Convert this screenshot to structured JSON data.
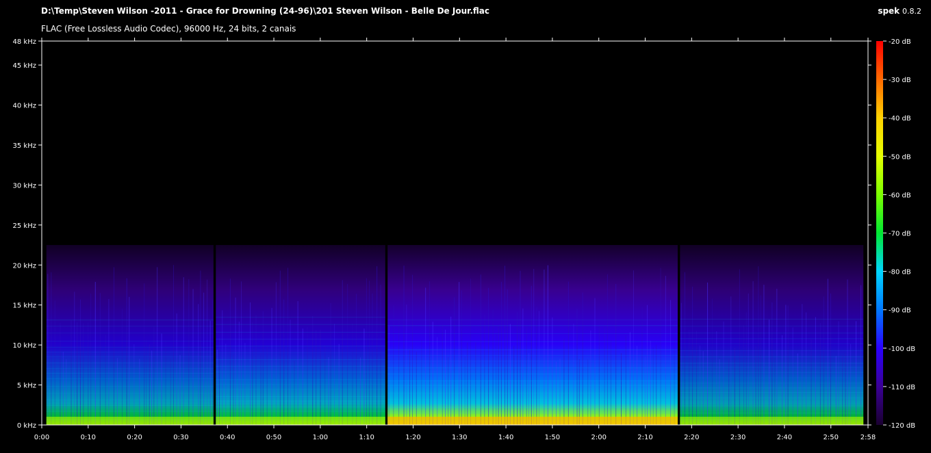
{
  "header": {
    "file_path": "D:\\Temp\\Steven Wilson -2011 - Grace for Drowning (24-96)\\201 Steven Wilson - Belle De Jour.flac",
    "codec_info": "FLAC (Free Lossless Audio Codec), 96000 Hz, 24 bits, 2 canais",
    "app_name": "spek",
    "app_version": "0.8.2"
  },
  "chart_data": {
    "type": "heatmap",
    "title": "D:\\Temp\\Steven Wilson -2011 - Grace for Drowning (24-96)\\201 Steven Wilson - Belle De Jour.flac",
    "subtitle": "FLAC (Free Lossless Audio Codec), 96000 Hz, 24 bits, 2 canais",
    "x_unit": "seconds",
    "xlim": [
      0,
      178
    ],
    "x_ticks": [
      0,
      10,
      20,
      30,
      40,
      50,
      60,
      70,
      80,
      90,
      100,
      110,
      120,
      130,
      140,
      150,
      160,
      170,
      178
    ],
    "x_tick_labels": [
      "0:00",
      "0:10",
      "0:20",
      "0:30",
      "0:40",
      "0:50",
      "1:00",
      "1:10",
      "1:20",
      "1:30",
      "1:40",
      "1:50",
      "2:00",
      "2:10",
      "2:20",
      "2:30",
      "2:40",
      "2:50",
      "2:58"
    ],
    "y_unit": "kHz",
    "ylim": [
      0,
      48
    ],
    "y_ticks": [
      0,
      5,
      10,
      15,
      20,
      25,
      30,
      35,
      40,
      45,
      48
    ],
    "y_tick_labels": [
      "0 kHz",
      "5 kHz",
      "10 kHz",
      "15 kHz",
      "20 kHz",
      "25 kHz",
      "30 kHz",
      "35 kHz",
      "40 kHz",
      "45 kHz",
      "48 kHz"
    ],
    "colorbar": {
      "range_db": [
        -120,
        -20
      ],
      "ticks": [
        -20,
        -30,
        -40,
        -50,
        -60,
        -70,
        -80,
        -90,
        -100,
        -110,
        -120
      ],
      "tick_labels": [
        "-20 dB",
        "-30 dB",
        "-40 dB",
        "-50 dB",
        "-60 dB",
        "-70 dB",
        "-80 dB",
        "-90 dB",
        "-100 dB",
        "-110 dB",
        "-120 dB"
      ],
      "colors": [
        "#ff0000",
        "#ff6a00",
        "#ffd200",
        "#e6ff00",
        "#7cff00",
        "#00e832",
        "#00d6ff",
        "#0078ff",
        "#2a00ff",
        "#3a0095",
        "#1a0030"
      ]
    },
    "content_cutoff_khz": 22.5,
    "segments": [
      {
        "start": 1,
        "end": 37,
        "intensity": 0.55
      },
      {
        "start": 37.5,
        "end": 74,
        "intensity": 0.62
      },
      {
        "start": 74.5,
        "end": 137,
        "intensity": 0.92
      },
      {
        "start": 137.5,
        "end": 177,
        "intensity": 0.52
      }
    ],
    "grid": false
  }
}
